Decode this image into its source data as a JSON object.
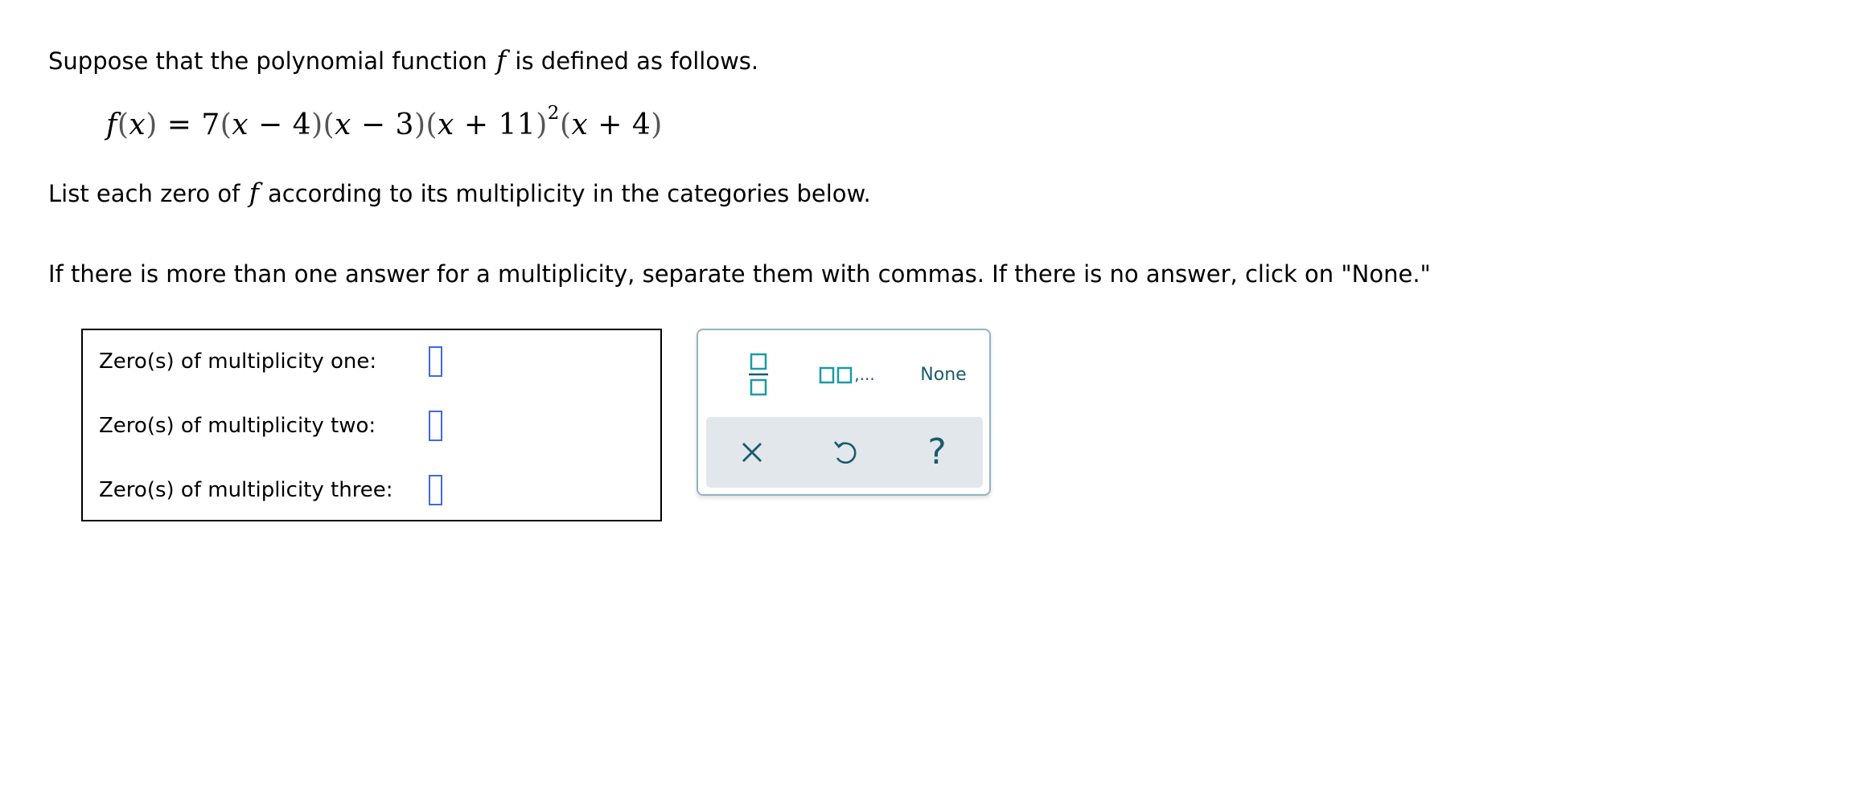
{
  "intro": {
    "before": "Suppose that the polynomial function",
    "func": "f",
    "after": "is defined as follows."
  },
  "formula": {
    "lhs_func": "f",
    "lhs_var": "x",
    "equals": "=",
    "coef": "7",
    "factor1": {
      "var": "x",
      "op": "−",
      "const": "4"
    },
    "factor2": {
      "var": "x",
      "op": "−",
      "const": "3"
    },
    "factor3": {
      "var": "x",
      "op": "+",
      "const": "11",
      "exponent": "2"
    },
    "factor4": {
      "var": "x",
      "op": "+",
      "const": "4"
    }
  },
  "instruction": {
    "before": "List each zero of",
    "func": "f",
    "after": "according to its multiplicity in the categories below."
  },
  "note": "If there is more than one answer for a multiplicity, separate them with commas. If there is no answer, click on \"None.\"",
  "answers": [
    {
      "label": "Zero(s) of multiplicity one:",
      "value": ""
    },
    {
      "label": "Zero(s) of multiplicity two:",
      "value": ""
    },
    {
      "label": "Zero(s) of multiplicity three:",
      "value": ""
    }
  ],
  "keypad": {
    "fraction_icon": "fraction-icon",
    "list_icon": "comma-list-icon",
    "list_suffix": ",...",
    "none_label": "None",
    "clear_icon": "close-icon",
    "undo_icon": "undo-icon",
    "help_label": "?"
  },
  "colors": {
    "input_border": "#3f6bd8",
    "keypad_accent": "#1b9aa6",
    "keypad_text": "#1b5a6b",
    "tray_bg": "#e1e7ea"
  }
}
